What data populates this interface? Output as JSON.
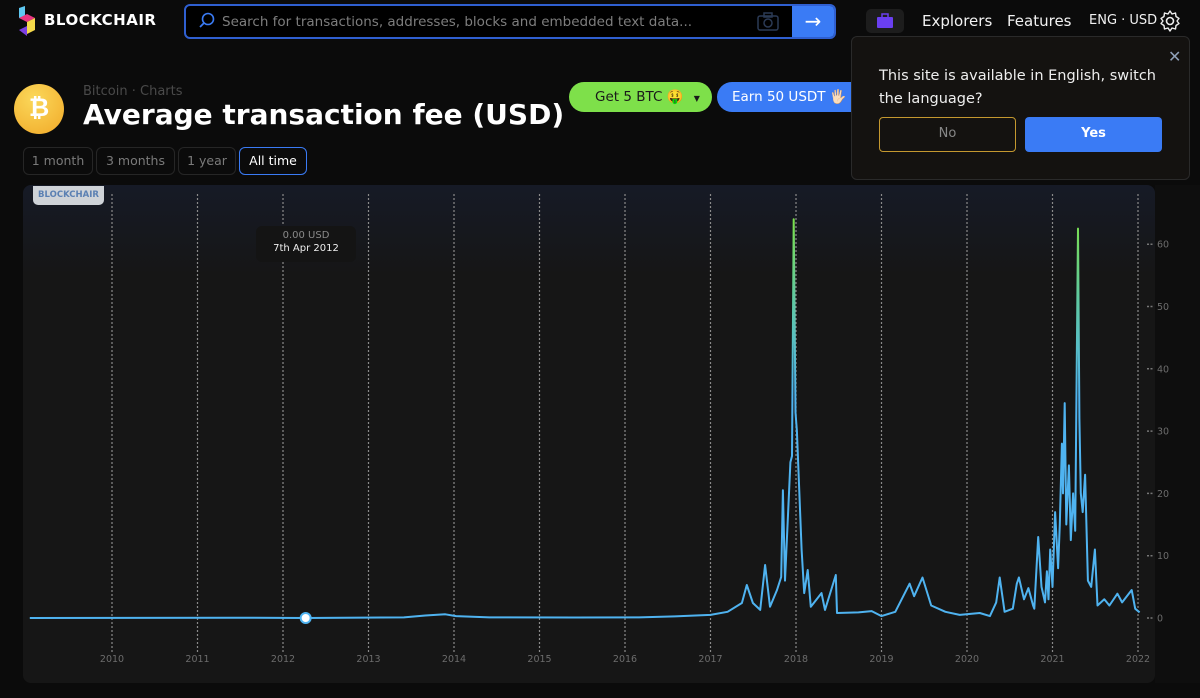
{
  "header": {
    "brand": "BLOCKCHAIR",
    "search_placeholder": "Search for transactions, addresses, blocks and embedded text data...",
    "nav": [
      "Explorers",
      "Features",
      "ENG · USD"
    ]
  },
  "page": {
    "breadcrumb": [
      "Bitcoin",
      "·",
      "Charts"
    ],
    "title": "Average transaction fee (USD)",
    "tabs": [
      {
        "label": "1 month",
        "active": false
      },
      {
        "label": "3 months",
        "active": false
      },
      {
        "label": "1 year",
        "active": false
      },
      {
        "label": "All time",
        "active": true
      }
    ],
    "promo": {
      "get_btc": "Get 5 BTC 🤑",
      "earn_usdt": "Earn 50 USDT 🖐🏻"
    }
  },
  "language_popup": {
    "message": "This site is available in English, switch the language?",
    "no": "No",
    "yes": "Yes"
  },
  "colors": {
    "accent": "#3a7bf5",
    "line": "#4fb3f0",
    "peak": "#7be04a",
    "promo_green": "#7ee04a",
    "bitcoin": "#f5b82e"
  },
  "chart_data": {
    "type": "line",
    "watermark": "BLOCKCHAIR",
    "x_ticks": [
      "2010",
      "2011",
      "2012",
      "2013",
      "2014",
      "2015",
      "2016",
      "2017",
      "2018",
      "2019",
      "2020",
      "2021",
      "2022"
    ],
    "y_ticks": [
      0,
      10,
      20,
      30,
      40,
      50,
      60
    ],
    "y_axis_position": "right",
    "xlim": [
      "2009-01-15",
      "2022-01-10"
    ],
    "ylim": [
      0,
      65
    ],
    "grid": "vertical dotted at years",
    "tooltip": {
      "value": "0.00 USD",
      "date": "7th Apr 2012",
      "x": "2012-04-07",
      "y": 0
    },
    "series": [
      {
        "points": [
          [
            "2009-01-15",
            0
          ],
          [
            "2011-06-01",
            0.05
          ],
          [
            "2012-04-07",
            0
          ],
          [
            "2013-06-01",
            0.1
          ],
          [
            "2013-09-01",
            0.4
          ],
          [
            "2013-11-25",
            0.6
          ],
          [
            "2014-01-10",
            0.3
          ],
          [
            "2014-06-01",
            0.1
          ],
          [
            "2015-06-01",
            0.08
          ],
          [
            "2016-03-01",
            0.1
          ],
          [
            "2016-08-01",
            0.25
          ],
          [
            "2017-01-01",
            0.5
          ],
          [
            "2017-03-15",
            1
          ],
          [
            "2017-05-15",
            2.4
          ],
          [
            "2017-06-05",
            5.3
          ],
          [
            "2017-07-01",
            2.4
          ],
          [
            "2017-08-01",
            1.3
          ],
          [
            "2017-08-22",
            8.5
          ],
          [
            "2017-09-12",
            1.8
          ],
          [
            "2017-10-12",
            4.5
          ],
          [
            "2017-10-30",
            6.6
          ],
          [
            "2017-11-06",
            20.5
          ],
          [
            "2017-11-15",
            6
          ],
          [
            "2017-12-08",
            25
          ],
          [
            "2017-12-15",
            26
          ],
          [
            "2017-12-22",
            64
          ],
          [
            "2017-12-30",
            33
          ],
          [
            "2018-01-05",
            30
          ],
          [
            "2018-01-25",
            11
          ],
          [
            "2018-02-05",
            4
          ],
          [
            "2018-02-20",
            7.7
          ],
          [
            "2018-03-05",
            1.8
          ],
          [
            "2018-04-20",
            4
          ],
          [
            "2018-05-05",
            1.3
          ],
          [
            "2018-06-20",
            6.9
          ],
          [
            "2018-06-25",
            0.8
          ],
          [
            "2018-09-25",
            0.9
          ],
          [
            "2018-11-20",
            1.1
          ],
          [
            "2019-01-01",
            0.3
          ],
          [
            "2019-03-01",
            1
          ],
          [
            "2019-05-01",
            5.5
          ],
          [
            "2019-05-20",
            3.5
          ],
          [
            "2019-06-25",
            6.5
          ],
          [
            "2019-08-01",
            2
          ],
          [
            "2019-10-01",
            1
          ],
          [
            "2019-12-01",
            0.5
          ],
          [
            "2020-02-25",
            0.8
          ],
          [
            "2020-04-08",
            0.3
          ],
          [
            "2020-05-05",
            2.5
          ],
          [
            "2020-05-20",
            6.5
          ],
          [
            "2020-06-10",
            1
          ],
          [
            "2020-07-15",
            1.5
          ],
          [
            "2020-08-01",
            5.5
          ],
          [
            "2020-08-10",
            6.5
          ],
          [
            "2020-09-01",
            3
          ],
          [
            "2020-09-20",
            4.8
          ],
          [
            "2020-10-10",
            2
          ],
          [
            "2020-10-15",
            1.5
          ],
          [
            "2020-11-01",
            13
          ],
          [
            "2020-11-15",
            5
          ],
          [
            "2020-11-30",
            2.5
          ],
          [
            "2020-12-08",
            7.5
          ],
          [
            "2020-12-15",
            3
          ],
          [
            "2020-12-22",
            11
          ],
          [
            "2021-01-01",
            5
          ],
          [
            "2021-01-12",
            17
          ],
          [
            "2021-01-25",
            8
          ],
          [
            "2021-02-01",
            15
          ],
          [
            "2021-02-10",
            28
          ],
          [
            "2021-02-15",
            20
          ],
          [
            "2021-02-22",
            34.5
          ],
          [
            "2021-03-01",
            15
          ],
          [
            "2021-03-12",
            24.5
          ],
          [
            "2021-03-20",
            12.5
          ],
          [
            "2021-03-30",
            20
          ],
          [
            "2021-04-08",
            14
          ],
          [
            "2021-04-20",
            62.5
          ],
          [
            "2021-04-26",
            32
          ],
          [
            "2021-05-02",
            20
          ],
          [
            "2021-05-10",
            17
          ],
          [
            "2021-05-20",
            23
          ],
          [
            "2021-06-01",
            6
          ],
          [
            "2021-06-15",
            5
          ],
          [
            "2021-07-01",
            11
          ],
          [
            "2021-07-12",
            2
          ],
          [
            "2021-08-10",
            3
          ],
          [
            "2021-09-01",
            2
          ],
          [
            "2021-10-05",
            3.9
          ],
          [
            "2021-10-25",
            2.5
          ],
          [
            "2021-12-05",
            4.5
          ],
          [
            "2021-12-20",
            1.5
          ],
          [
            "2022-01-08",
            0.9
          ]
        ]
      }
    ]
  }
}
